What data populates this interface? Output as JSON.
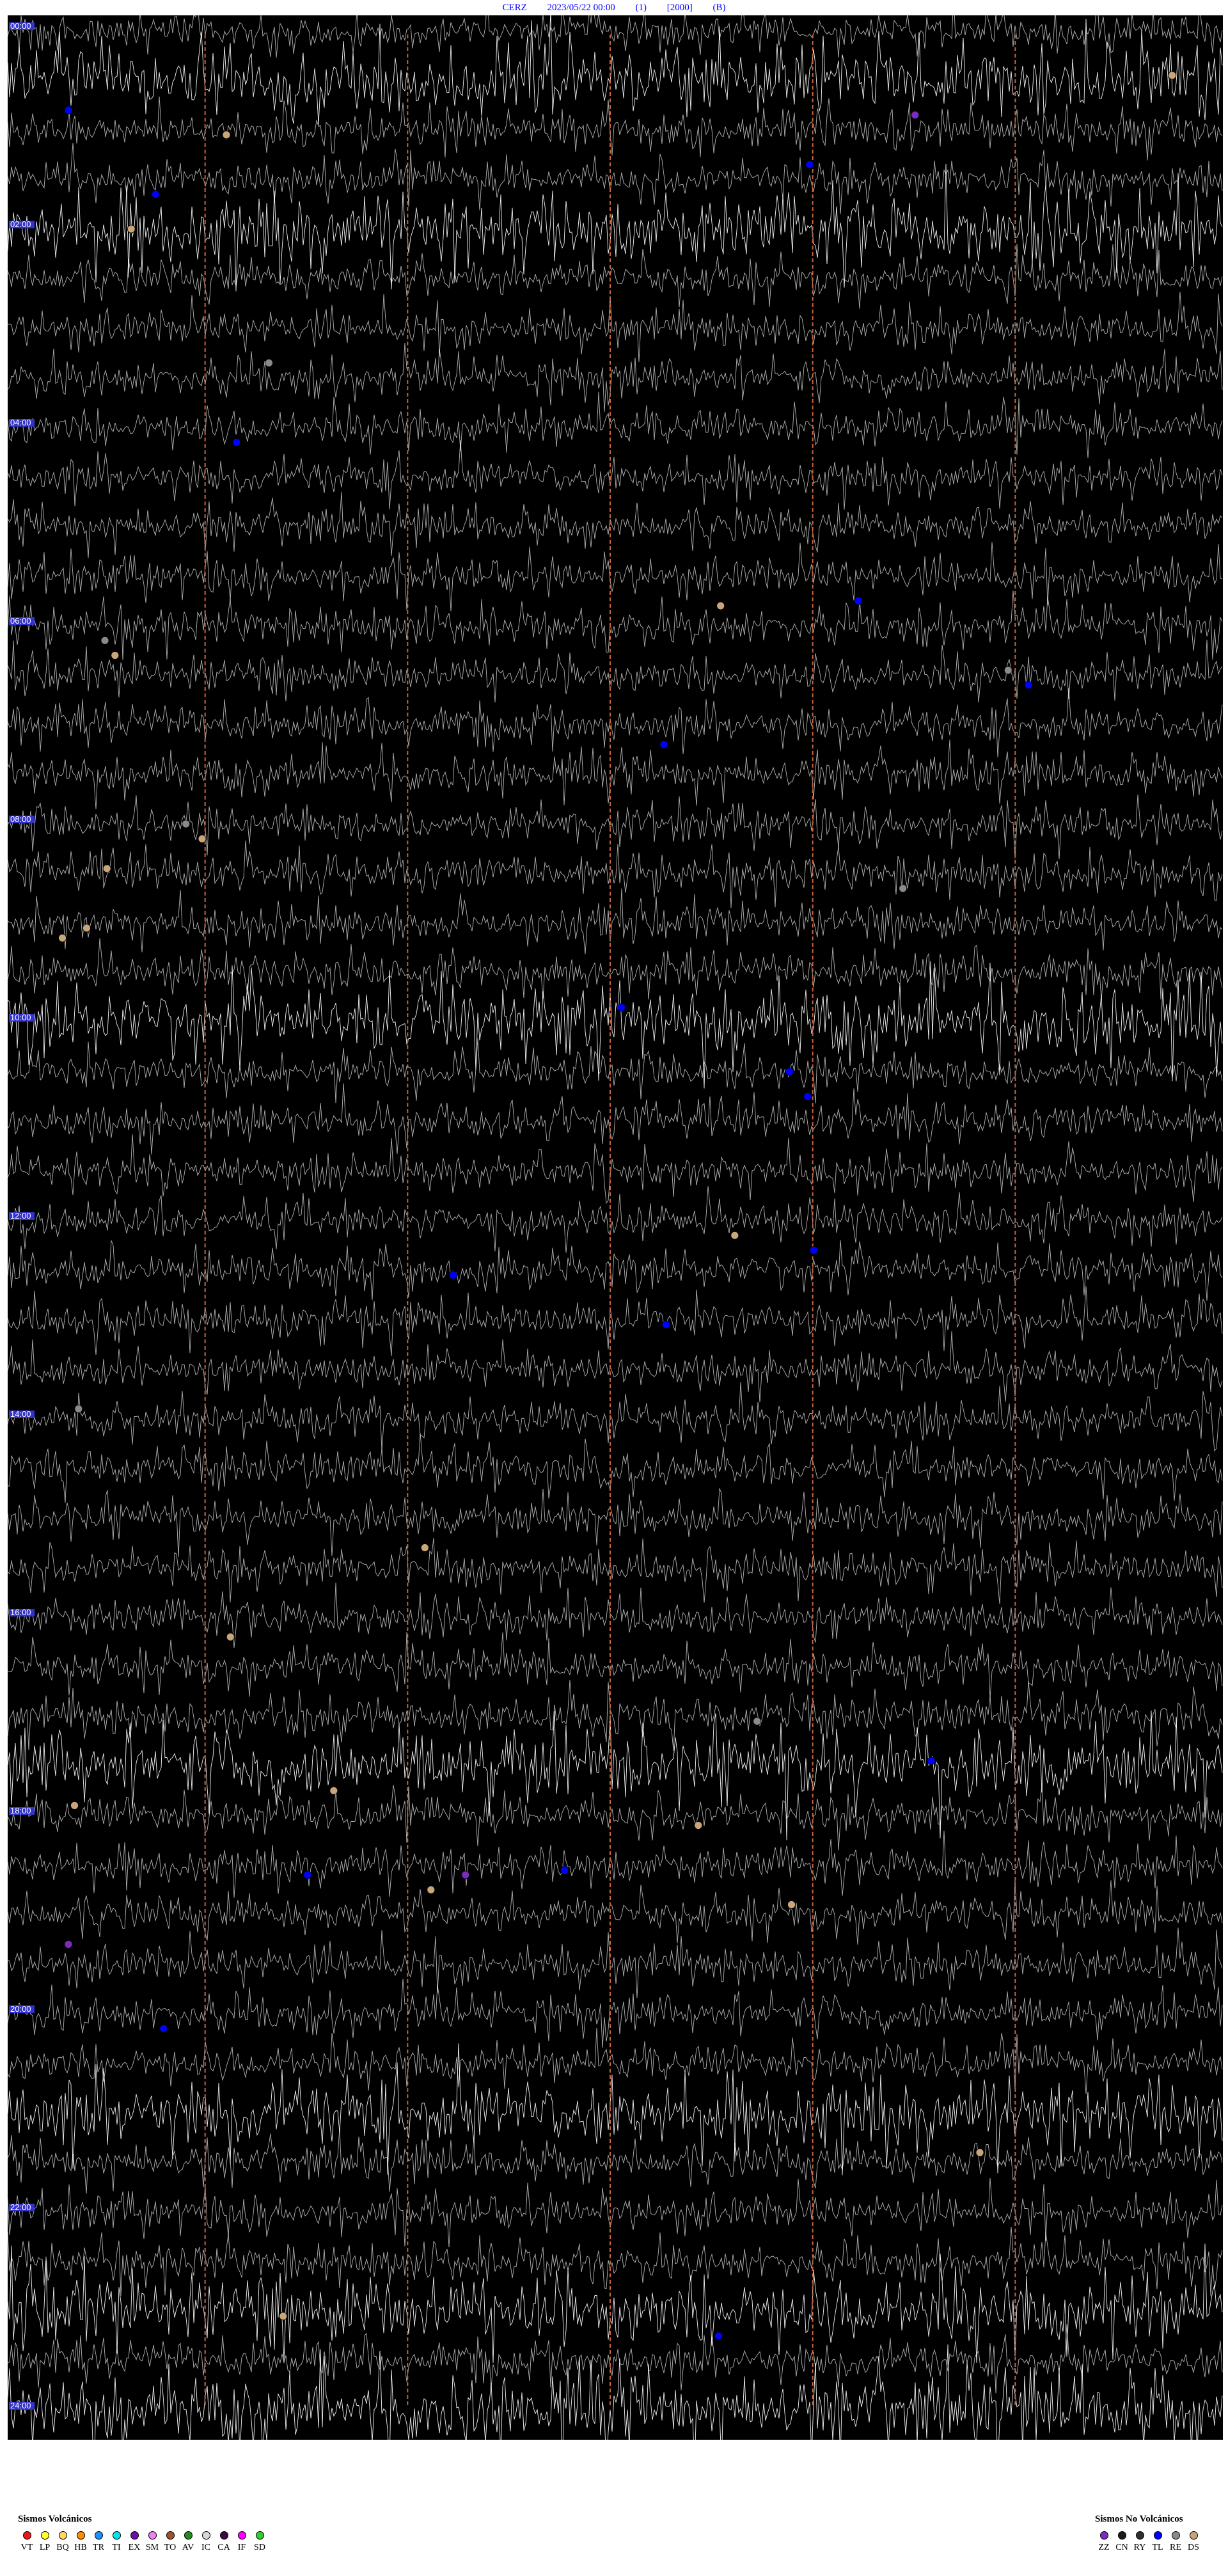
{
  "header": {
    "station": "CERZ",
    "datetime": "2023/05/22 00:00",
    "channel": "(1)",
    "scale": "[2000]",
    "flag": "(B)"
  },
  "chart_data": {
    "type": "helicorder",
    "background": "#000000",
    "trace_color": "#ffffff",
    "divider_color": "#c8643c",
    "hour_labels": [
      "00:00",
      "02:00",
      "04:00",
      "06:00",
      "08:00",
      "10:00",
      "12:00",
      "14:00",
      "16:00",
      "18:00",
      "20:00",
      "22:00",
      "24:00"
    ],
    "minute_dividers": [
      10,
      20,
      30,
      40,
      50
    ],
    "rows_per_hour": 2,
    "hours": 24,
    "events": [
      {
        "row": 0.9,
        "minute": 57.5,
        "type": "DS"
      },
      {
        "row": 1.6,
        "minute": 3.0,
        "type": "TL"
      },
      {
        "row": 1.7,
        "minute": 44.8,
        "type": "ZZ"
      },
      {
        "row": 2.1,
        "minute": 10.8,
        "type": "DS"
      },
      {
        "row": 2.7,
        "minute": 39.6,
        "type": "TL"
      },
      {
        "row": 3.3,
        "minute": 7.3,
        "type": "TL"
      },
      {
        "row": 4.0,
        "minute": 6.1,
        "type": "DS"
      },
      {
        "row": 6.7,
        "minute": 12.9,
        "type": "RE"
      },
      {
        "row": 8.3,
        "minute": 11.3,
        "type": "TL"
      },
      {
        "row": 11.5,
        "minute": 42.0,
        "type": "TL"
      },
      {
        "row": 11.6,
        "minute": 35.2,
        "type": "DS"
      },
      {
        "row": 12.3,
        "minute": 4.8,
        "type": "RE"
      },
      {
        "row": 12.6,
        "minute": 5.3,
        "type": "DS"
      },
      {
        "row": 12.9,
        "minute": 49.4,
        "type": "RE"
      },
      {
        "row": 13.2,
        "minute": 50.4,
        "type": "TL"
      },
      {
        "row": 14.4,
        "minute": 32.4,
        "type": "TL"
      },
      {
        "row": 16.0,
        "minute": 8.8,
        "type": "RE"
      },
      {
        "row": 16.3,
        "minute": 9.6,
        "type": "DS"
      },
      {
        "row": 16.9,
        "minute": 4.9,
        "type": "DS"
      },
      {
        "row": 17.3,
        "minute": 44.2,
        "type": "RE"
      },
      {
        "row": 18.1,
        "minute": 3.9,
        "type": "DS"
      },
      {
        "row": 18.3,
        "minute": 2.7,
        "type": "DS"
      },
      {
        "row": 19.7,
        "minute": 30.3,
        "type": "TL"
      },
      {
        "row": 21.0,
        "minute": 38.6,
        "type": "TL"
      },
      {
        "row": 21.5,
        "minute": 39.5,
        "type": "TL"
      },
      {
        "row": 24.3,
        "minute": 35.9,
        "type": "DS"
      },
      {
        "row": 24.6,
        "minute": 39.8,
        "type": "TL"
      },
      {
        "row": 25.1,
        "minute": 22.0,
        "type": "TL"
      },
      {
        "row": 26.1,
        "minute": 32.5,
        "type": "TL"
      },
      {
        "row": 27.8,
        "minute": 3.5,
        "type": "RE"
      },
      {
        "row": 30.6,
        "minute": 20.6,
        "type": "DS"
      },
      {
        "row": 32.4,
        "minute": 11.0,
        "type": "DS"
      },
      {
        "row": 34.1,
        "minute": 37.0,
        "type": "RE"
      },
      {
        "row": 34.9,
        "minute": 45.6,
        "type": "TL"
      },
      {
        "row": 35.5,
        "minute": 16.1,
        "type": "DS"
      },
      {
        "row": 35.8,
        "minute": 3.3,
        "type": "DS"
      },
      {
        "row": 36.2,
        "minute": 34.1,
        "type": "DS"
      },
      {
        "row": 37.2,
        "minute": 14.8,
        "type": "TL"
      },
      {
        "row": 37.2,
        "minute": 22.6,
        "type": "ZZ"
      },
      {
        "row": 37.1,
        "minute": 27.5,
        "type": "TL"
      },
      {
        "row": 37.5,
        "minute": 20.9,
        "type": "DS"
      },
      {
        "row": 37.8,
        "minute": 38.7,
        "type": "DS"
      },
      {
        "row": 38.6,
        "minute": 3.0,
        "type": "ZZ"
      },
      {
        "row": 40.3,
        "minute": 7.7,
        "type": "TL"
      },
      {
        "row": 42.8,
        "minute": 48.0,
        "type": "DS"
      },
      {
        "row": 46.1,
        "minute": 13.6,
        "type": "DS"
      },
      {
        "row": 46.5,
        "minute": 35.1,
        "type": "TL"
      }
    ]
  },
  "legend": {
    "volcanic_title": "Sismos Volcánicos",
    "volcanic": [
      {
        "code": "VT",
        "color": "#e41a1c"
      },
      {
        "code": "LP",
        "color": "#ffff33"
      },
      {
        "code": "BQ",
        "color": "#ffd966"
      },
      {
        "code": "HB",
        "color": "#ff8c00"
      },
      {
        "code": "TR",
        "color": "#1e90ff"
      },
      {
        "code": "TI",
        "color": "#00e5ee"
      },
      {
        "code": "EX",
        "color": "#6a0dad"
      },
      {
        "code": "SM",
        "color": "#ee82ee"
      },
      {
        "code": "TO",
        "color": "#a0522d"
      },
      {
        "code": "AV",
        "color": "#228b22"
      },
      {
        "code": "IC",
        "color": "#d9d9d9"
      },
      {
        "code": "CA",
        "color": "#3d0a3d"
      },
      {
        "code": "IF",
        "color": "#ff00ff"
      },
      {
        "code": "SD",
        "color": "#32cd32"
      }
    ],
    "nonvolcanic_title": "Sismos No Volcánicos",
    "nonvolcanic": [
      {
        "code": "ZZ",
        "color": "#7b2cbf"
      },
      {
        "code": "CN",
        "color": "#1a1a1a"
      },
      {
        "code": "RY",
        "color": "#2f2f2f"
      },
      {
        "code": "TL",
        "color": "#0000ff"
      },
      {
        "code": "RE",
        "color": "#8a8a8a"
      },
      {
        "code": "DS",
        "color": "#c9a67a"
      }
    ]
  }
}
